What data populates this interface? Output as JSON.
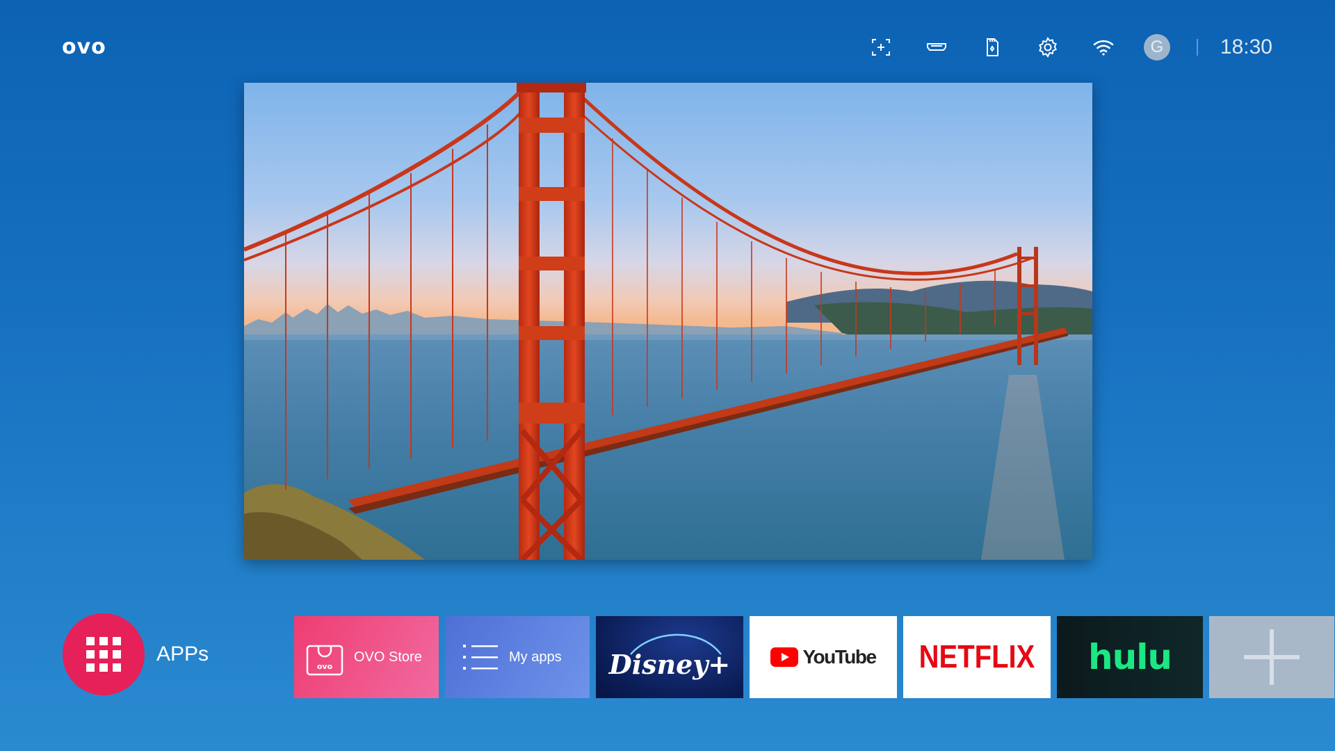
{
  "brand": {
    "logo": "ovo"
  },
  "status_bar": {
    "icons": [
      "screen-add-icon",
      "hdmi-icon",
      "storage-icon",
      "gear-icon",
      "wifi-icon"
    ],
    "avatar_letter": "G",
    "time": "18:30"
  },
  "hero": {
    "icon": "golden-gate-bridge-image"
  },
  "launcher": {
    "label": "APPs",
    "icon": "grid-icon",
    "color": "#e62058"
  },
  "tiles": [
    {
      "name": "ovo-store",
      "label": "OVO Store",
      "icon": "shopping-bag-icon",
      "bag_text": "ovo"
    },
    {
      "name": "my-apps",
      "label": "My apps",
      "icon": "list-icon"
    },
    {
      "name": "disney-plus",
      "label": "Disney+"
    },
    {
      "name": "youtube",
      "label": "YouTube"
    },
    {
      "name": "netflix",
      "label": "NETFLIX",
      "color": "#e50914"
    },
    {
      "name": "hulu",
      "label": "hulu",
      "color": "#1ce783"
    },
    {
      "name": "add",
      "icon": "plus-icon"
    }
  ]
}
